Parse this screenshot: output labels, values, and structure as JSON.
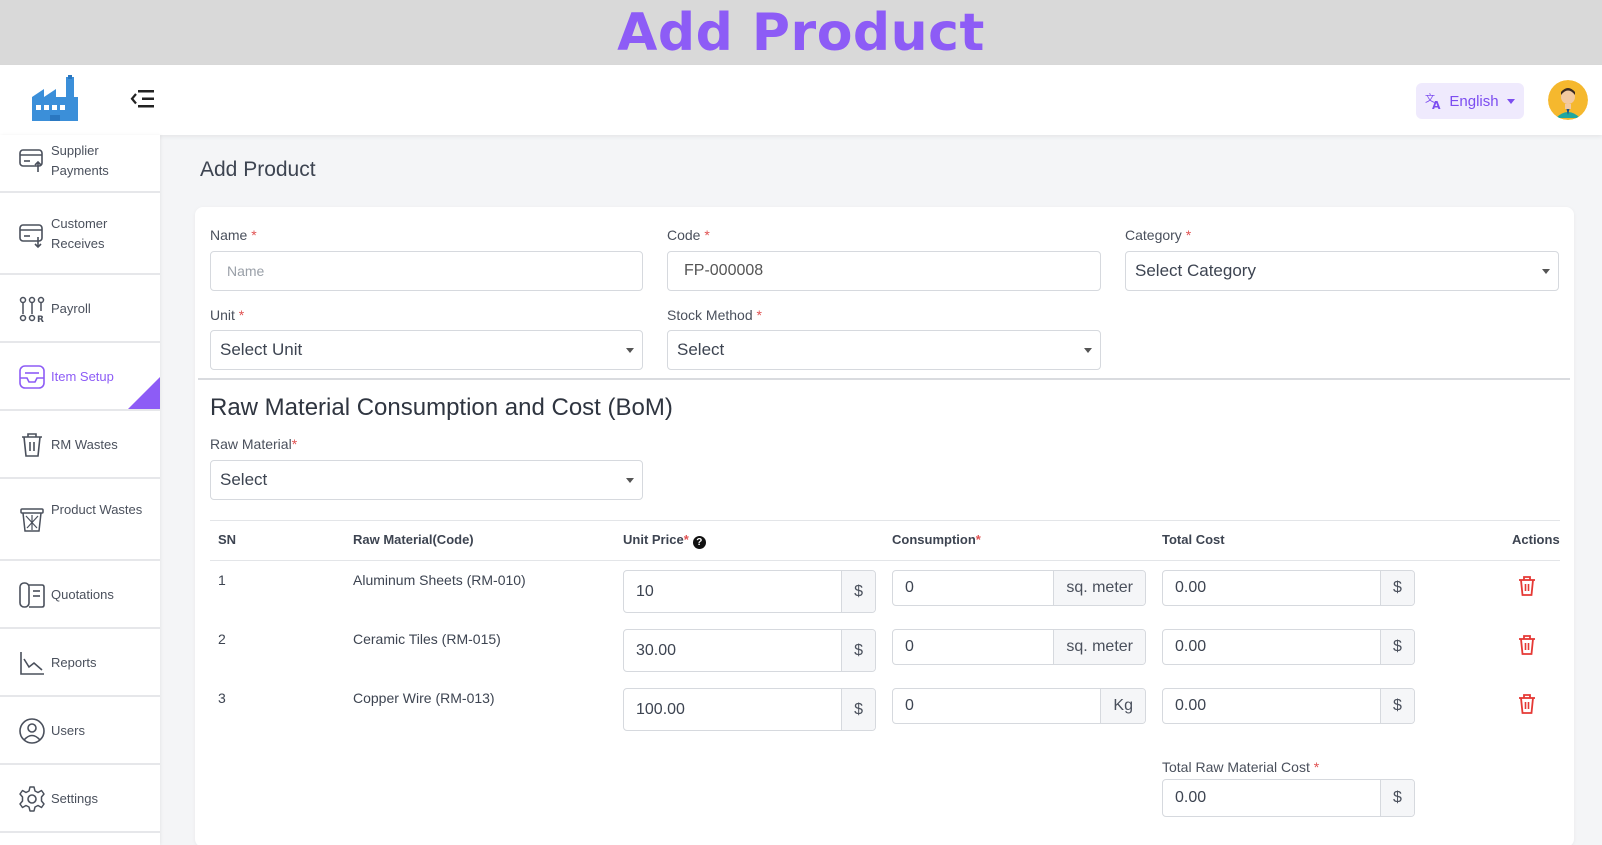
{
  "banner": {
    "title": "Add Product"
  },
  "topbar": {
    "language": "English"
  },
  "sidebar": {
    "items": [
      {
        "label": "Supplier Payments",
        "icon": "supplier-payments-icon"
      },
      {
        "label": "Customer Receives",
        "icon": "customer-receives-icon"
      },
      {
        "label": "Payroll",
        "icon": "payroll-icon"
      },
      {
        "label": "Item Setup",
        "icon": "item-setup-icon",
        "active": true
      },
      {
        "label": "RM Wastes",
        "icon": "trash-icon"
      },
      {
        "label": "Product Wastes",
        "icon": "waste-basket-icon"
      },
      {
        "label": "Quotations",
        "icon": "quotations-icon"
      },
      {
        "label": "Reports",
        "icon": "chart-line-icon"
      },
      {
        "label": "Users",
        "icon": "user-circle-icon"
      },
      {
        "label": "Settings",
        "icon": "gear-icon"
      }
    ]
  },
  "page": {
    "title": "Add Product"
  },
  "form": {
    "name": {
      "label": "Name",
      "placeholder": "Name",
      "value": ""
    },
    "code": {
      "label": "Code",
      "value": "FP-000008"
    },
    "category": {
      "label": "Category",
      "value": "Select Category"
    },
    "unit": {
      "label": "Unit",
      "value": "Select Unit"
    },
    "stock_method": {
      "label": "Stock Method",
      "value": "Select"
    },
    "required_marker": "*"
  },
  "bom": {
    "title": "Raw Material Consumption and Cost (BoM)",
    "raw_material": {
      "label": "Raw Material",
      "value": "Select"
    },
    "columns": {
      "sn": "SN",
      "raw_material": "Raw Material(Code)",
      "unit_price": "Unit Price",
      "consumption": "Consumption",
      "total_cost": "Total Cost",
      "actions": "Actions"
    },
    "help_glyph": "?",
    "currency": "$",
    "rows": [
      {
        "sn": "1",
        "material": "Aluminum Sheets (RM-010)",
        "unit_price": "10",
        "consumption": "0",
        "consumption_unit": "sq. meter",
        "total": "0.00"
      },
      {
        "sn": "2",
        "material": "Ceramic Tiles (RM-015)",
        "unit_price": "30.00",
        "consumption": "0",
        "consumption_unit": "sq. meter",
        "total": "0.00"
      },
      {
        "sn": "3",
        "material": "Copper Wire (RM-013)",
        "unit_price": "100.00",
        "consumption": "0",
        "consumption_unit": "Kg",
        "total": "0.00"
      }
    ],
    "total_label": "Total Raw Material Cost",
    "total_value": "0.00"
  },
  "colors": {
    "accent": "#8d5cf6",
    "danger": "#e53935"
  }
}
